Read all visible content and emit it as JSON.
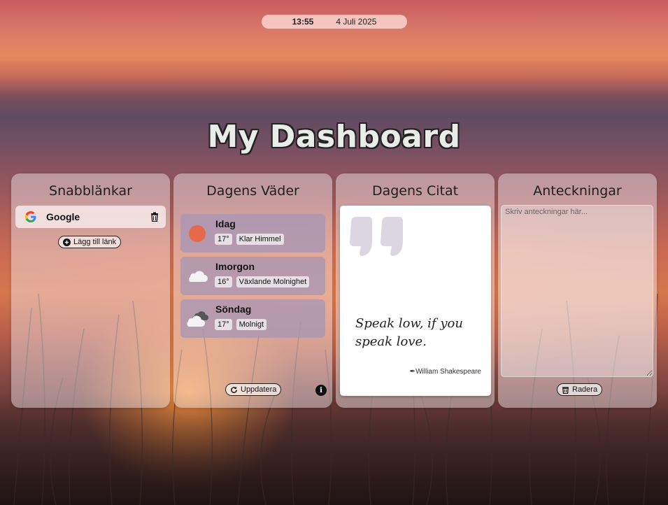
{
  "clock": {
    "time": "13:55",
    "date": "4 Juli 2025"
  },
  "page_title": "My Dashboard",
  "links_card": {
    "title": "Snabblänkar",
    "links": [
      {
        "name": "Google",
        "icon": "google-icon"
      }
    ],
    "add_label": "Lägg till länk"
  },
  "weather_card": {
    "title": "Dagens Väder",
    "days": [
      {
        "day": "Idag",
        "temp": "17°",
        "desc": "Klar Himmel",
        "icon": "sun-icon"
      },
      {
        "day": "Imorgon",
        "temp": "16°",
        "desc": "Växlande Molnighet",
        "icon": "cloud-icon"
      },
      {
        "day": "Söndag",
        "temp": "17°",
        "desc": "Molnigt",
        "icon": "clouds-icon"
      }
    ],
    "refresh_label": "Uppdatera",
    "info_label": "i"
  },
  "quote_card": {
    "title": "Dagens Citat",
    "text": "Speak low, if you speak love.",
    "author": "William Shakespeare"
  },
  "notes_card": {
    "title": "Anteckningar",
    "placeholder": "Skriv anteckningar här...",
    "clear_label": "Radera"
  },
  "colors": {
    "sun": "#e8684a",
    "weather_panel": "#a596b4",
    "quote_mark": "#dcd6e0"
  }
}
